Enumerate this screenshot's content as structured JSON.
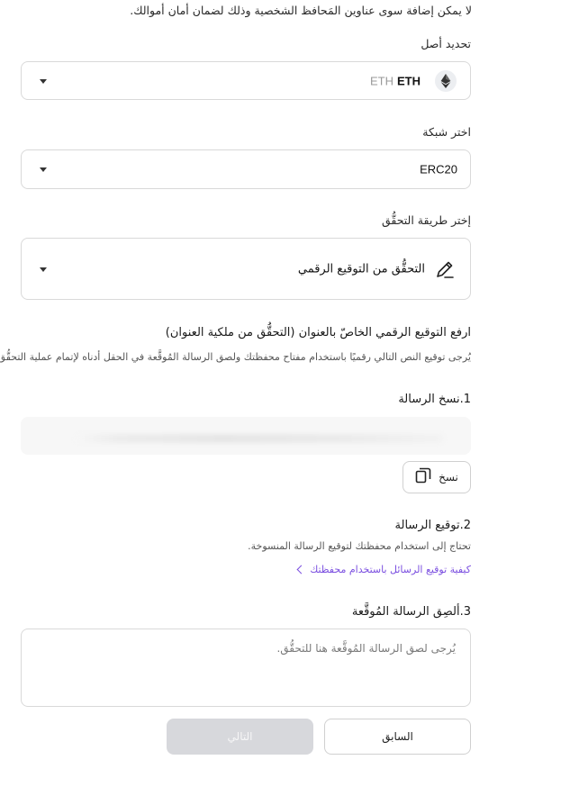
{
  "notice": "لا يمكن إضافة سوى عناوين المَحافظ الشخصية وذلك لضمان أمان أموالك.",
  "asset": {
    "label": "تحديد أصل",
    "symbol": "ETH",
    "name": "ETH",
    "icon": "ethereum-icon"
  },
  "network": {
    "label": "اختر شبكة",
    "value": "ERC20"
  },
  "verification": {
    "label": "إختر طريقة التحقُّق",
    "value": "التحقُّق من التوقيع الرقمي",
    "icon": "pen-icon"
  },
  "upload": {
    "heading": "ارفع التوقيع الرقمي الخاصّ بالعنوان (التحقُّق من ملكية العنوان)",
    "description": "يُرجى توقيع النص التالي رقميًا باستخدام مفتاح محفظتك ولصق الرسالة المُوقَّعة في الحقل أدناه لإتمام عملية التحقُّق."
  },
  "step1": {
    "title": "1.نسخ الرسالة",
    "copy_label": "نسخ"
  },
  "step2": {
    "title": "2.توقيع الرسالة",
    "description": "تحتاج إلى استخدام محفظتك لتوقيع الرسالة المنسوخة.",
    "link": "كيفية توقيع الرسائل باستخدام محفظتك"
  },
  "step3": {
    "title": "3.ألصِق الرسالة المُوقَّعة",
    "placeholder": "يُرجى لصق الرسالة المُوقَّعة هنا للتحقُّق."
  },
  "buttons": {
    "previous": "السابق",
    "next": "التالي"
  },
  "colors": {
    "accent_link": "#7b4fe0",
    "disabled_button": "#d7d8dc",
    "border": "#d9d9d9"
  }
}
